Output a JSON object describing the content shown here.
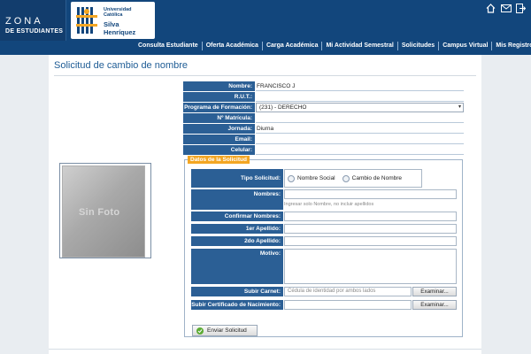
{
  "app": {
    "zona_title": "ZONA",
    "zona_subtitle": "DE ESTUDIANTES",
    "university_line1": "Universidad",
    "university_line2": "Católica",
    "university_line3": "Silva",
    "university_line4": "Henríquez"
  },
  "top_icons": [
    "home-icon",
    "mail-icon",
    "logout-icon"
  ],
  "nav": [
    "Consulta Estudiante",
    "Oferta Académica",
    "Carga Académica",
    "Mi Actividad Semestral",
    "Solicitudes",
    "Campus Virtual",
    "Mis Registros"
  ],
  "page": {
    "title": "Solicitud de cambio de nombre",
    "photo_text": "Sin Foto"
  },
  "info": {
    "nombre_label": "Nombre:",
    "nombre_value": "FRANCISCO J",
    "rut_label": "R.U.T.:",
    "rut_value": "",
    "programa_label": "Programa de Formación:",
    "programa_value": "(231) - DERECHO",
    "matricula_label": "Nº Matrícula:",
    "matricula_value": "",
    "jornada_label": "Jornada:",
    "jornada_value": "Diurna",
    "email_label": "Email:",
    "email_value": "",
    "celular_label": "Celular:",
    "celular_value": ""
  },
  "form": {
    "legend": "Datos de la Solicitud",
    "tipo_label": "Tipo Solicitud:",
    "radio_options": [
      "Nombre Social",
      "Cambio de Nombre"
    ],
    "nombres_label": "Nombres:",
    "nombres_hint": "Ingresar solo Nombre, no incluir apellidos",
    "confirmar_label": "Confirmar Nombres:",
    "apellido1_label": "1er Apellido:",
    "apellido2_label": "2do Apellido:",
    "motivo_label": "Motivo:",
    "carnet_label": "Subir Carnet:",
    "carnet_placeholder": "Cédula de identidad por ambos lados",
    "certificado_label": "Subir Certificado de Nacimiento:",
    "browse_label": "Examinar...",
    "send_label": "Enviar Solicitud"
  },
  "colors": {
    "header": "#12467c",
    "label_bg": "#2b5f95",
    "legend_bg": "#f3a623",
    "title": "#1e5c95"
  }
}
